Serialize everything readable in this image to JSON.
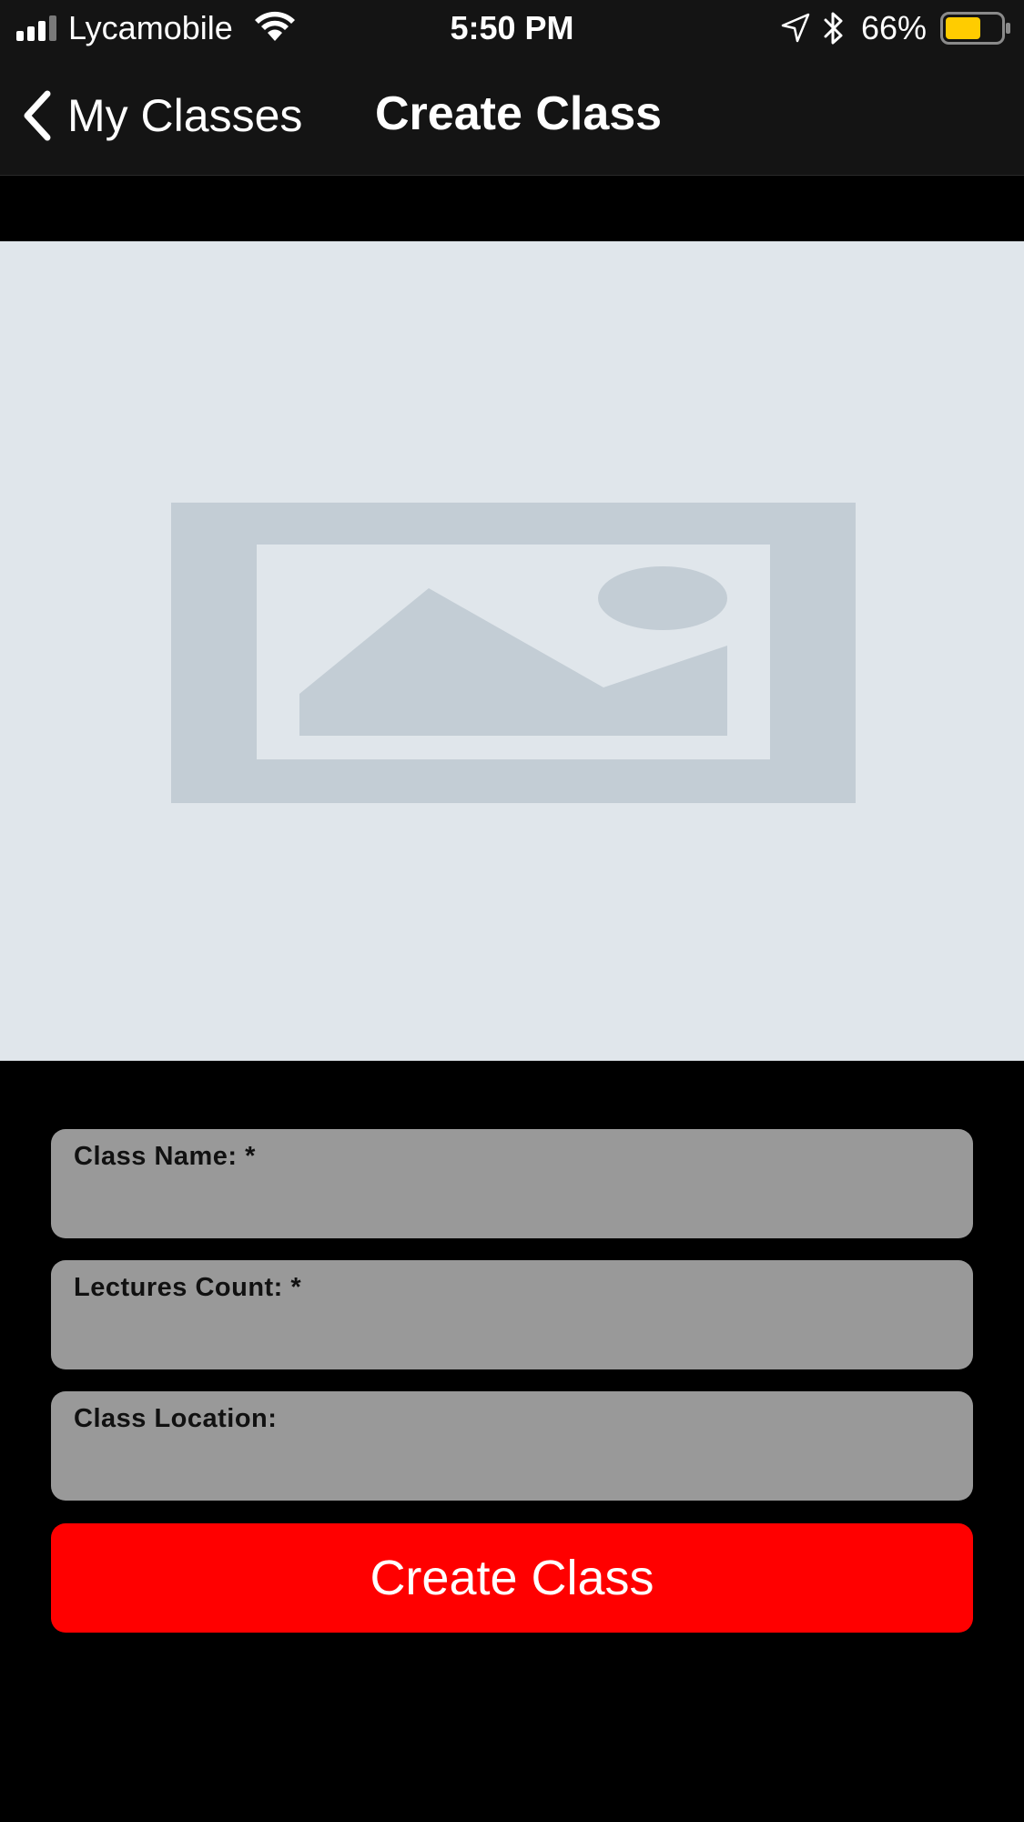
{
  "status_bar": {
    "carrier": "Lycamobile",
    "time": "5:50 PM",
    "battery_percent": "66%",
    "battery_level": 0.66,
    "battery_color": "#ffcc00",
    "icons": [
      "signal-icon",
      "wifi-icon",
      "location-arrow-icon",
      "bluetooth-icon",
      "battery-icon"
    ]
  },
  "nav": {
    "back_label": "My Classes",
    "title": "Create Class"
  },
  "image_placeholder": {
    "icon": "image-placeholder-icon"
  },
  "form": {
    "fields": [
      {
        "label": "Class Name: *",
        "value": ""
      },
      {
        "label": "Lectures Count: *",
        "value": ""
      },
      {
        "label": "Class Location:",
        "value": ""
      }
    ],
    "submit_label": "Create Class"
  },
  "colors": {
    "background": "#000000",
    "bar": "#141414",
    "placeholder_bg": "#e0e6eb",
    "placeholder_fg": "#c3cdd5",
    "field_bg": "#999999",
    "accent": "#ff0000"
  }
}
